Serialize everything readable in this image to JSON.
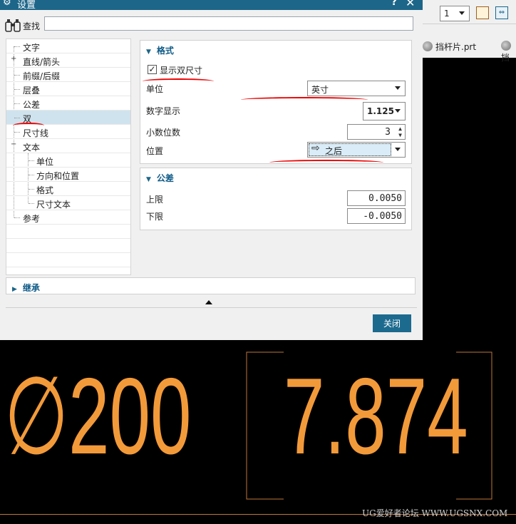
{
  "dialog": {
    "title": "设置",
    "find_label": "查找",
    "find_value": ""
  },
  "tree": {
    "items": [
      "文字",
      "直线/箭头",
      "前缀/后缀",
      "层叠",
      "公差",
      "双",
      "尺寸线",
      "文本",
      "单位",
      "方向和位置",
      "格式",
      "尺寸文本",
      "参考"
    ],
    "expanders": [
      "+",
      "−"
    ],
    "selected": "双"
  },
  "format_panel": {
    "header": "格式",
    "show_dual_label": "显示双尺寸",
    "show_dual_checked": true,
    "unit_label": "单位",
    "unit_value": "英寸",
    "numeric_label": "数字显示",
    "numeric_value": "1.125",
    "decimals_label": "小数位数",
    "decimals_value": "3",
    "position_label": "位置",
    "position_value": "之后"
  },
  "tolerance_panel": {
    "header": "公差",
    "upper_label": "上限",
    "upper_value": "0.0050",
    "lower_label": "下限",
    "lower_value": "-0.0050"
  },
  "inherit_panel": {
    "header": "继承"
  },
  "close_button": "关闭",
  "toolbar": {
    "combo_value": "1",
    "file_tab": "挡杆片.prt",
    "file_tab_2": "挡"
  },
  "graphics": {
    "primary_dim": "∅200",
    "dual_dim": "7.874",
    "watermark": "UG爱好者论坛 WWW.UGSNX.COM"
  },
  "colors": {
    "titlebar": "#1d6689",
    "accent": "#0e5a86",
    "cad_text": "#f29a3a",
    "annotation": "#e00000"
  }
}
